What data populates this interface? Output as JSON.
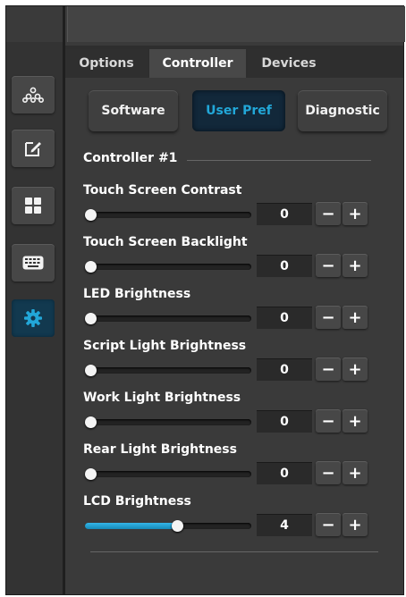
{
  "tabs": [
    {
      "label": "Options",
      "active": false
    },
    {
      "label": "Controller",
      "active": true
    },
    {
      "label": "Devices",
      "active": false
    }
  ],
  "subtabs": [
    {
      "label": "Software",
      "active": false
    },
    {
      "label": "User Pref",
      "active": true
    },
    {
      "label": "Diagnostic",
      "active": false
    }
  ],
  "sidebar": [
    {
      "icon": "network-icon",
      "active": false
    },
    {
      "icon": "edit-icon",
      "active": false
    },
    {
      "icon": "grid-icon",
      "active": false
    },
    {
      "icon": "keyboard-icon",
      "active": false
    },
    {
      "icon": "gear-icon",
      "active": true
    }
  ],
  "section_title": "Controller #1",
  "settings": [
    {
      "label": "Touch Screen Contrast",
      "value": "0",
      "level": 0
    },
    {
      "label": "Touch Screen Backlight",
      "value": "0",
      "level": 0
    },
    {
      "label": "LED Brightness",
      "value": "0",
      "level": 0
    },
    {
      "label": "Script Light Brightness",
      "value": "0",
      "level": 0
    },
    {
      "label": "Work Light Brightness",
      "value": "0",
      "level": 0
    },
    {
      "label": "Rear Light Brightness",
      "value": "0",
      "level": 0
    },
    {
      "label": "LCD Brightness",
      "value": "4",
      "level": 0.56
    }
  ],
  "stepper": {
    "minus": "−",
    "plus": "+"
  },
  "colors": {
    "accent": "#22a7d8",
    "background": "#3a3a3a"
  }
}
